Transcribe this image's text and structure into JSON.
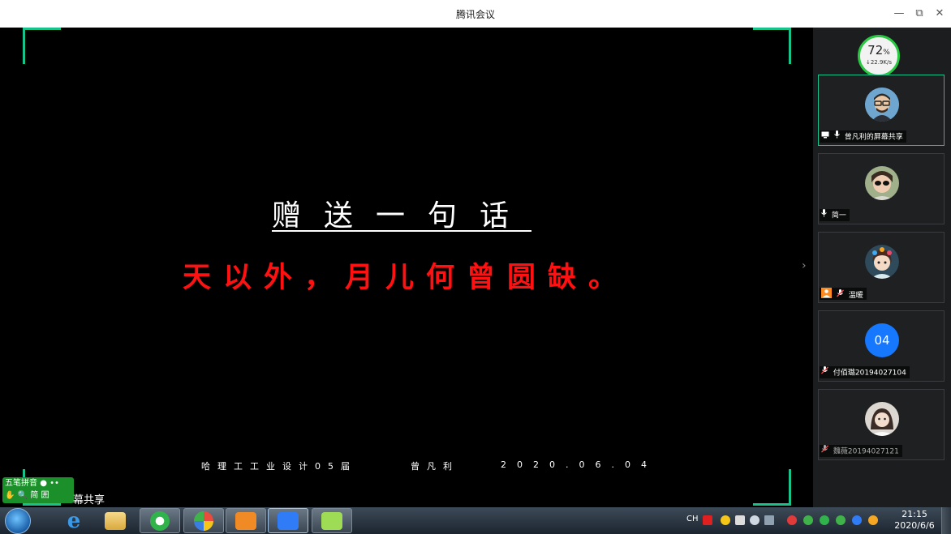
{
  "window": {
    "title": "腾讯会议",
    "minimize_glyph": "—",
    "restore_glyph": "⧉",
    "close_glyph": "✕"
  },
  "slide": {
    "heading": "赠送一句话",
    "quote": "天以外，月儿何曾圆缺。",
    "footer_school": "哈理工工业设计05届",
    "footer_name": "曾凡利",
    "footer_date": "2020.06.04"
  },
  "network": {
    "percent": "72",
    "percent_unit": "%",
    "speed": "↓22.9K/s"
  },
  "participants": [
    {
      "name": "曾凡利的屏幕共享",
      "icon": "avatar-glasses"
    },
    {
      "name": "简一",
      "icon": "avatar-photo"
    },
    {
      "name": "温暖",
      "icon": "avatar-cartoon"
    },
    {
      "name": "付佰璐20194027104",
      "icon": "avatar-number",
      "initials": "04"
    },
    {
      "name": "魏薇20194027121",
      "icon": "avatar-photo"
    }
  ],
  "ime": {
    "line1": "五笔拼音",
    "line2": "简 囲"
  },
  "share_label_partial": "幕共享",
  "tray": {
    "lang": "CH"
  },
  "clock": {
    "time": "21:15",
    "date": "2020/6/6"
  },
  "colors": {
    "accent": "#19c28b",
    "quote_red": "#ff1111",
    "network_green": "#28c840",
    "number_avatar": "#1677ff"
  }
}
